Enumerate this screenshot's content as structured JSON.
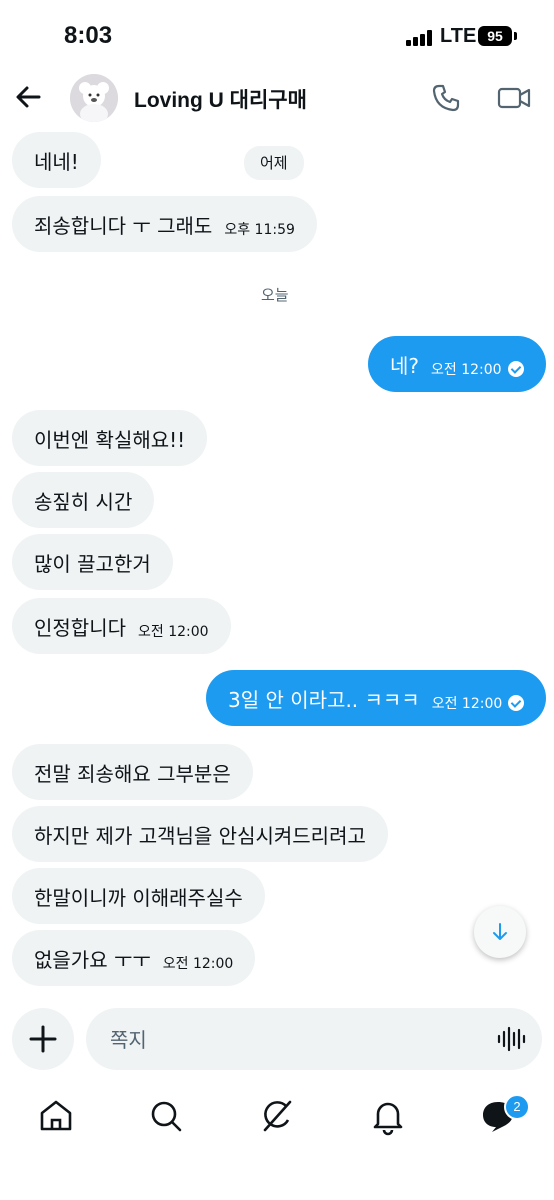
{
  "status_bar": {
    "time": "8:03",
    "network": "LTE",
    "battery": "95"
  },
  "header": {
    "contact_name": "Loving U 대리구매",
    "icons": [
      "back-arrow-icon",
      "phone-icon",
      "video-camera-icon"
    ]
  },
  "day_labels": {
    "yesterday": "어제",
    "today": "오늘"
  },
  "messages": [
    {
      "dir": "in",
      "text": "네네!",
      "time": ""
    },
    {
      "dir": "in",
      "text": "죄송합니다 ㅜ 그래도",
      "time": "오후 11:59"
    },
    {
      "dir": "out",
      "text": "네?",
      "time": "오전 12:00"
    },
    {
      "dir": "in",
      "text": "이번엔 확실해요!!",
      "time": ""
    },
    {
      "dir": "in",
      "text": "송짚히 시간",
      "time": ""
    },
    {
      "dir": "in",
      "text": "많이 끌고한거",
      "time": ""
    },
    {
      "dir": "in",
      "text": "인정합니다",
      "time": "오전 12:00"
    },
    {
      "dir": "out",
      "text": "3일 안 이라고.. ㅋㅋㅋ",
      "time": "오전 12:00"
    },
    {
      "dir": "in",
      "text": "전말 죄송해요 그부분은",
      "time": ""
    },
    {
      "dir": "in",
      "text": "하지만 제가 고객님을 안심시켜드리려고",
      "time": ""
    },
    {
      "dir": "in",
      "text": "한말이니까 이해래주실수",
      "time": ""
    },
    {
      "dir": "in",
      "text": "없을가요 ㅜㅜ",
      "time": "오전 12:00"
    }
  ],
  "composer": {
    "placeholder": "쪽지"
  },
  "bottom_nav": {
    "items": [
      "home-icon",
      "search-icon",
      "grok-icon",
      "notifications-icon",
      "messages-icon"
    ],
    "messages_badge": "2"
  },
  "colors": {
    "accent": "#1d9bf0",
    "incoming_bubble": "#eff3f4",
    "text": "#0f1419",
    "muted": "#536471"
  }
}
